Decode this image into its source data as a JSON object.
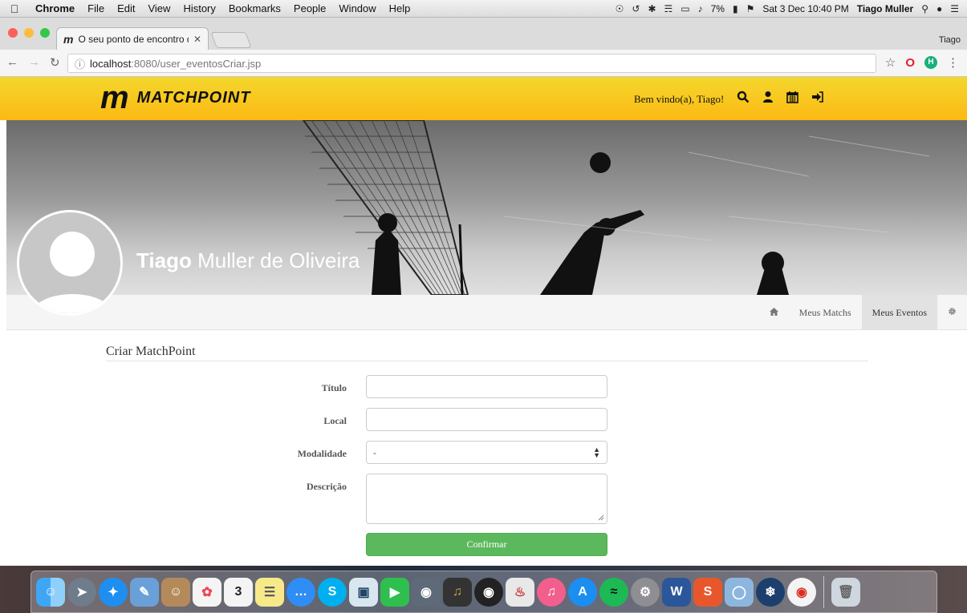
{
  "menubar": {
    "app": "Chrome",
    "items": [
      "File",
      "Edit",
      "View",
      "History",
      "Bookmarks",
      "People",
      "Window",
      "Help"
    ],
    "battery": "7%",
    "datetime": "Sat 3 Dec 10:40 PM",
    "user": "Tiago Muller"
  },
  "browser": {
    "tab_title": "O seu ponto de encontro dos e",
    "profile_name": "Tiago",
    "url_host": "localhost",
    "url_path": ":8080/user_eventosCriar.jsp"
  },
  "site": {
    "logo_text": "MATCHPOINT",
    "welcome": "Bem vindo(a), Tiago!",
    "header_icons": [
      "search-icon",
      "user-icon",
      "calendar-icon",
      "sign-out-icon"
    ]
  },
  "profile": {
    "first_name": "Tiago",
    "last_name": "Muller de Oliveira"
  },
  "subnav": {
    "home_icon": "home-icon",
    "items": [
      {
        "label": "Meus Matchs"
      },
      {
        "label": "Meus Eventos"
      }
    ],
    "settings_icon": "gear-icon"
  },
  "form": {
    "title": "Criar MatchPoint",
    "fields": {
      "titulo_label": "Título",
      "local_label": "Local",
      "modalidade_label": "Modalidade",
      "modalidade_value": "-",
      "descricao_label": "Descrição"
    },
    "submit": "Confirmar"
  },
  "colors": {
    "header_yellow": "#f9c41f",
    "confirm_green": "#5cb85c"
  }
}
